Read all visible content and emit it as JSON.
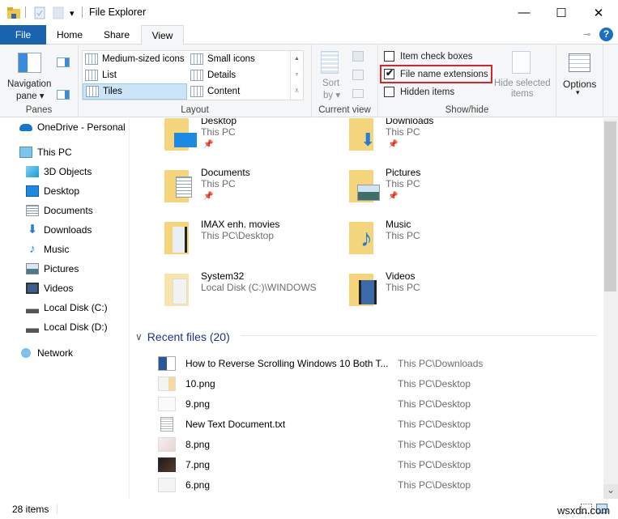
{
  "window": {
    "title": "File Explorer",
    "minimize_glyph": "—",
    "maximize_glyph": "☐",
    "close_glyph": "✕"
  },
  "quick_access": {
    "customize_glyph": "▾"
  },
  "tabs": [
    {
      "label": "File"
    },
    {
      "label": "Home"
    },
    {
      "label": "Share"
    },
    {
      "label": "View",
      "active": true
    }
  ],
  "ribbon_help_glyph": "?",
  "ribbon": {
    "panes": {
      "navigation_pane_label_1": "Navigation",
      "navigation_pane_label_2": "pane ▾",
      "group_label": "Panes"
    },
    "layout": {
      "items": [
        {
          "label": "Medium-sized icons"
        },
        {
          "label": "Small icons"
        },
        {
          "label": "List"
        },
        {
          "label": "Details"
        },
        {
          "label": "Tiles",
          "selected": true
        },
        {
          "label": "Content"
        }
      ],
      "group_label": "Layout",
      "scroll_up_glyph": "▲",
      "scroll_down_glyph": "▼",
      "more_glyph": "⩡"
    },
    "current_view": {
      "sort_label_1": "Sort",
      "sort_label_2": "by ▾",
      "group_label": "Current view"
    },
    "show_hide": {
      "item_check_boxes": {
        "label": "Item check boxes",
        "checked": false
      },
      "file_name_extensions": {
        "label": "File name extensions",
        "checked": true
      },
      "hidden_items": {
        "label": "Hidden items",
        "checked": false
      },
      "hide_selected_1": "Hide selected",
      "hide_selected_2": "items",
      "group_label": "Show/hide"
    },
    "options": {
      "label": "Options",
      "arrow": "▾"
    }
  },
  "nav_pane": {
    "items": [
      {
        "label": "OneDrive - Personal",
        "icon": "onedrive-icon"
      },
      {
        "label": "This PC",
        "icon": "computer-icon"
      },
      {
        "label": "3D Objects",
        "icon": "3d-objects-icon"
      },
      {
        "label": "Desktop",
        "icon": "desktop-icon"
      },
      {
        "label": "Documents",
        "icon": "documents-icon"
      },
      {
        "label": "Downloads",
        "icon": "downloads-icon"
      },
      {
        "label": "Music",
        "icon": "music-icon"
      },
      {
        "label": "Pictures",
        "icon": "pictures-icon"
      },
      {
        "label": "Videos",
        "icon": "videos-icon"
      },
      {
        "label": "Local Disk (C:)",
        "icon": "drive-icon"
      },
      {
        "label": "Local Disk (D:)",
        "icon": "drive-icon"
      },
      {
        "label": "Network",
        "icon": "network-icon"
      }
    ]
  },
  "quick_access_tiles": [
    {
      "name": "Desktop",
      "location": "This PC",
      "pinned": true
    },
    {
      "name": "Downloads",
      "location": "This PC",
      "pinned": true
    },
    {
      "name": "Documents",
      "location": "This PC",
      "pinned": true
    },
    {
      "name": "Pictures",
      "location": "This PC",
      "pinned": true
    },
    {
      "name": "IMAX enh. movies",
      "location": "This PC\\Desktop",
      "pinned": false
    },
    {
      "name": "Music",
      "location": "This PC",
      "pinned": false
    },
    {
      "name": "System32",
      "location": "Local Disk (C:)\\WINDOWS",
      "pinned": false
    },
    {
      "name": "Videos",
      "location": "This PC",
      "pinned": false
    }
  ],
  "recent_files": {
    "header": "Recent files (20)",
    "chevron_glyph": "∨",
    "items": [
      {
        "name": "How to Reverse Scrolling Windows 10 Both T...",
        "location": "This PC\\Downloads",
        "icon": "word-doc-icon"
      },
      {
        "name": "10.png",
        "location": "This PC\\Desktop",
        "icon": "image-thumb-icon"
      },
      {
        "name": "9.png",
        "location": "This PC\\Desktop",
        "icon": "image-thumb-icon"
      },
      {
        "name": "New Text Document.txt",
        "location": "This PC\\Desktop",
        "icon": "text-doc-icon"
      },
      {
        "name": "8.png",
        "location": "This PC\\Desktop",
        "icon": "image-thumb-icon"
      },
      {
        "name": "7.png",
        "location": "This PC\\Desktop",
        "icon": "image-thumb-dark-icon"
      },
      {
        "name": "6.png",
        "location": "This PC\\Desktop",
        "icon": "image-thumb-icon"
      }
    ]
  },
  "status_bar": {
    "item_count": "28 items"
  },
  "scrollbar": {
    "down_glyph": "⌄"
  },
  "watermark": "wsxdn.com"
}
